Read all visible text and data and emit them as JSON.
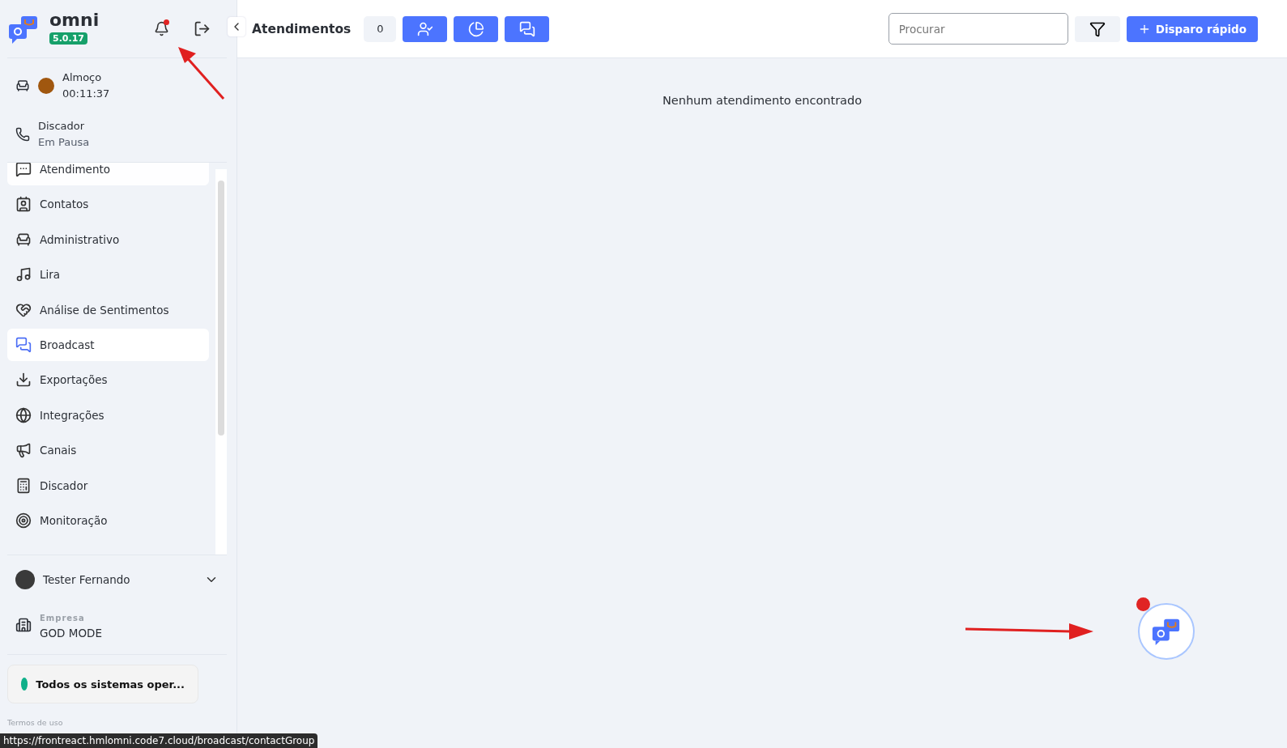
{
  "brand": {
    "name": "omni",
    "version": "5.0.17",
    "notification": true
  },
  "status": {
    "label": "Almoço",
    "time": "00:11:37",
    "color": "#a0570f"
  },
  "dialer": {
    "label": "Discador",
    "state": "Em Pausa"
  },
  "menu": [
    {
      "label": "Atendimento",
      "selected": false,
      "hovered": true
    },
    {
      "label": "Contatos",
      "selected": false,
      "hovered": false
    },
    {
      "label": "Administrativo",
      "selected": false,
      "hovered": false
    },
    {
      "label": "Lira",
      "selected": false,
      "hovered": false
    },
    {
      "label": "Análise de Sentimentos",
      "selected": false,
      "hovered": false
    },
    {
      "label": "Broadcast",
      "selected": true,
      "hovered": false
    },
    {
      "label": "Exportações",
      "selected": false,
      "hovered": false
    },
    {
      "label": "Integrações",
      "selected": false,
      "hovered": false
    },
    {
      "label": "Canais",
      "selected": false,
      "hovered": false
    },
    {
      "label": "Discador",
      "selected": false,
      "hovered": false
    },
    {
      "label": "Monitoração",
      "selected": false,
      "hovered": false
    }
  ],
  "user": {
    "name": "Tester Fernando",
    "expanded": false
  },
  "company": {
    "caption": "Empresa",
    "name": "GOD MODE"
  },
  "system_status": {
    "label": "Todos os sistemas oper...",
    "color": "#10b08a"
  },
  "footer_links": [
    "Termos de uso"
  ],
  "header": {
    "title": "Atendimentos",
    "count": "0",
    "search": {
      "placeholder": "Procurar"
    },
    "action": "Disparo rápido"
  },
  "empty_message": "Nenhum atendimento encontrado",
  "chat_widget": {
    "notification": true
  },
  "status_url": "https://frontreact.hmlomni.code7.cloud/broadcast/contactGroup"
}
